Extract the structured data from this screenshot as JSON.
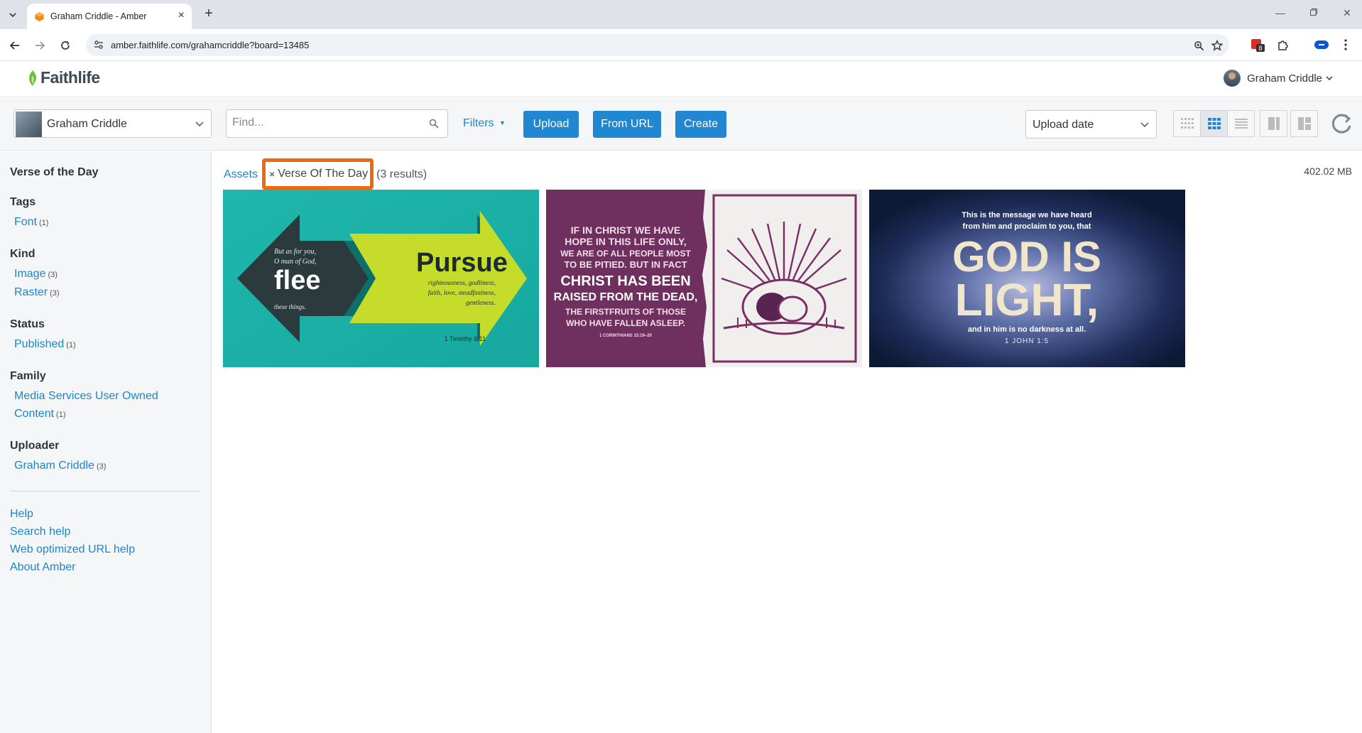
{
  "browser": {
    "tab_title": "Graham Criddle - Amber",
    "url": "amber.faithlife.com/grahamcriddle?board=13485",
    "extension_badge": "8"
  },
  "app": {
    "logo": "Faithlife",
    "user_name": "Graham Criddle"
  },
  "toolbar": {
    "account_name": "Graham Criddle",
    "find_placeholder": "Find...",
    "filters_label": "Filters",
    "upload_label": "Upload",
    "from_url_label": "From URL",
    "create_label": "Create",
    "sort_label": "Upload date"
  },
  "sidebar": {
    "board_title": "Verse of the Day",
    "tags_heading": "Tags",
    "tag_font": "Font",
    "tag_font_count": "(1)",
    "kind_heading": "Kind",
    "kind_image": "Image",
    "kind_image_count": "(3)",
    "kind_raster": "Raster",
    "kind_raster_count": "(3)",
    "status_heading": "Status",
    "status_published": "Published",
    "status_published_count": "(1)",
    "family_heading": "Family",
    "family_line1": "Media Services User Owned",
    "family_line2": "Content",
    "family_count": "(1)",
    "uploader_heading": "Uploader",
    "uploader_name": "Graham Criddle",
    "uploader_count": "(3)",
    "help": "Help",
    "search_help": "Search help",
    "web_url_help": "Web optimized URL help",
    "about": "About Amber"
  },
  "main": {
    "crumb_assets": "Assets",
    "chip_remove": "×",
    "chip_label": "Verse Of The Day",
    "results": "(3 results)",
    "storage": "402.02 MB"
  },
  "thumbs": {
    "t1": {
      "small_1": "But as for you,",
      "small_2": "O man of God,",
      "flee": "flee",
      "small_3": "these things.",
      "pursue": "Pursue",
      "p1": "righteousness, godliness,",
      "p2": "faith, love, steadfastness,",
      "p3": "gentleness.",
      "ref": "1 Timothy 6:11"
    },
    "t2": {
      "l1": "IF IN CHRIST WE HAVE",
      "l2": "HOPE IN THIS LIFE ONLY,",
      "l3": "WE ARE OF ALL PEOPLE MOST",
      "l4": "TO BE PITIED. BUT IN FACT",
      "l5": "CHRIST HAS BEEN",
      "l6": "RAISED FROM THE DEAD,",
      "l7": "THE FIRSTFRUITS OF THOSE",
      "l8": "WHO HAVE FALLEN ASLEEP.",
      "ref": "1 CORINTHIANS 15:19–20"
    },
    "t3": {
      "l1": "This is the message we have heard",
      "l2": "from him and proclaim to you, that",
      "big1": "GOD IS",
      "big2": "LIGHT,",
      "l3": "and in him is no darkness at all.",
      "ref": "1 JOHN 1:5"
    }
  },
  "colors": {
    "link": "#1a87c9",
    "button": "#2087d0",
    "chip_border": "#ea6b12",
    "logo_green": "#6abf3b"
  }
}
